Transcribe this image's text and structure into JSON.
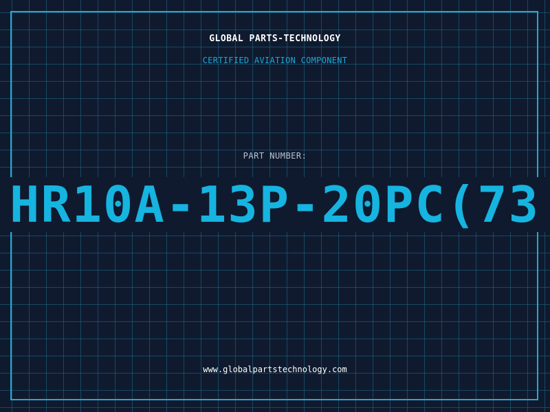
{
  "header": {
    "brand": "GLOBAL PARTS-TECHNOLOGY",
    "subtitle": "CERTIFIED AVIATION COMPONENT"
  },
  "part": {
    "label": "PART NUMBER:",
    "number": "HR10A-13P-20PC(73"
  },
  "footer": {
    "website": "www.globalpartstechnology.com"
  },
  "colors": {
    "background": "#0f1a2e",
    "grid": "#1e6e8c",
    "accent": "#16b4e0",
    "frame": "#2aa7cf",
    "text": "#ffffff",
    "muted": "#b8c3d1"
  }
}
